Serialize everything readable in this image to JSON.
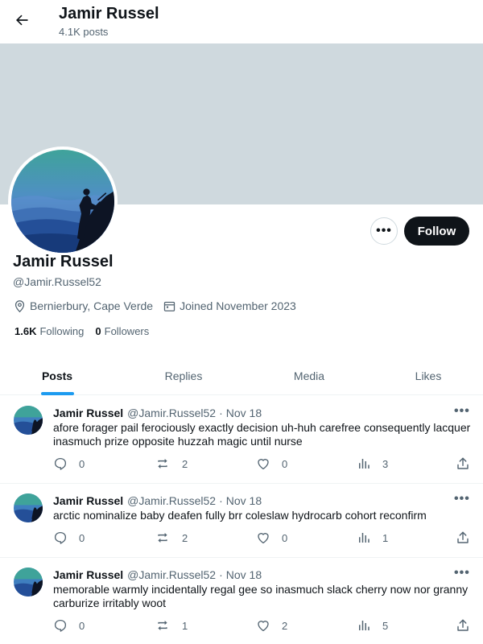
{
  "header": {
    "title": "Jamir Russel",
    "posts_count": "4.1K posts"
  },
  "profile": {
    "name": "Jamir Russel",
    "handle": "@Jamir.Russel52",
    "location": "Bernierbury, Cape Verde",
    "joined": "Joined November 2023",
    "following_count": "1.6K",
    "following_label": "Following",
    "followers_count": "0",
    "followers_label": "Followers",
    "follow_button": "Follow",
    "more_label": "•••"
  },
  "tabs": [
    {
      "label": "Posts",
      "active": true
    },
    {
      "label": "Replies",
      "active": false
    },
    {
      "label": "Media",
      "active": false
    },
    {
      "label": "Likes",
      "active": false
    }
  ],
  "posts": [
    {
      "name": "Jamir Russel",
      "handle": "@Jamir.Russel52",
      "separator": "·",
      "date": "Nov 18",
      "text": "afore forager pail ferociously exactly decision uh-huh carefree consequently lacquer inasmuch prize opposite huzzah magic until nurse",
      "replies": "0",
      "reposts": "2",
      "likes": "0",
      "views": "3",
      "more": "•••"
    },
    {
      "name": "Jamir Russel",
      "handle": "@Jamir.Russel52",
      "separator": "·",
      "date": "Nov 18",
      "text": "arctic nominalize baby deafen fully brr coleslaw hydrocarb cohort reconfirm",
      "replies": "0",
      "reposts": "2",
      "likes": "0",
      "views": "1",
      "more": "•••"
    },
    {
      "name": "Jamir Russel",
      "handle": "@Jamir.Russel52",
      "separator": "·",
      "date": "Nov 18",
      "text": "memorable warmly incidentally regal gee so inasmuch slack cherry now nor granny carburize irritably woot",
      "replies": "0",
      "reposts": "1",
      "likes": "2",
      "views": "5",
      "more": "•••"
    }
  ],
  "colors": {
    "accent": "#1d9bf0",
    "text": "#0f1419",
    "muted": "#536471",
    "banner": "#cfd9de"
  }
}
